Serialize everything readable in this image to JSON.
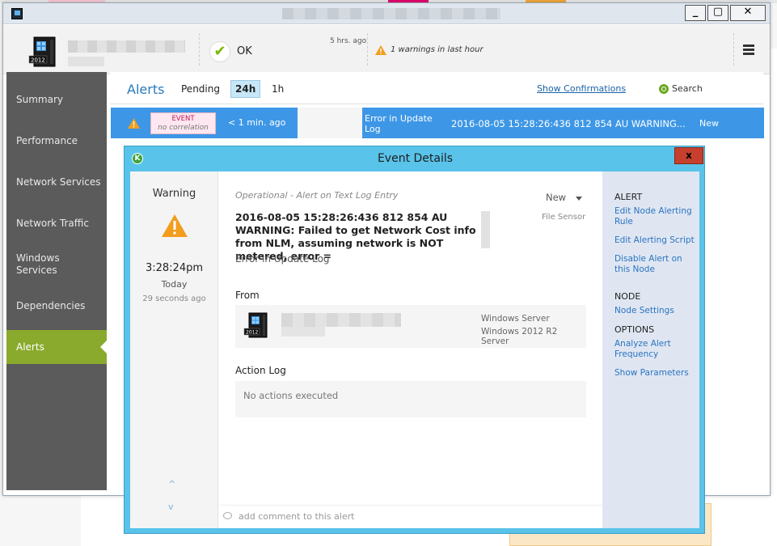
{
  "header": {
    "status_text": "OK",
    "status_time": "5 hrs. ago",
    "warnings_text": "1 warnings in last hour"
  },
  "sidebar": {
    "items": [
      {
        "label": "Summary"
      },
      {
        "label": "Performance"
      },
      {
        "label": "Network Services"
      },
      {
        "label": "Network Traffic"
      },
      {
        "label": "Windows Services"
      },
      {
        "label": "Dependencies"
      },
      {
        "label": "Alerts",
        "active": true
      }
    ]
  },
  "alerts": {
    "title": "Alerts",
    "tabs": [
      "Pending",
      "24h",
      "1h"
    ],
    "selected_tab": "24h",
    "show_confirmations": "Show Confirmations",
    "search_label": "Search",
    "row": {
      "type_label": "EVENT",
      "correlation": "no correlation",
      "time": "< 1 min. ago",
      "title": "Error in Update Log",
      "message": "2016-08-05 15:28:26:436 812 854 AU WARNING...",
      "status": "New"
    }
  },
  "dialog": {
    "title": "Event Details",
    "close_label": "x",
    "severity": "Warning",
    "time": "3:28:24pm",
    "day": "Today",
    "ago": "29 seconds ago",
    "event_type": "Operational - Alert on Text Log Entry",
    "status": "New",
    "sensor": "File Sensor",
    "message": "2016-08-05 15:28:26:436 812 854 AU WARNING: Failed to get Network Cost info from NLM, assuming network is NOT metered, error =",
    "subtitle": "Error in Update Log",
    "from_label": "From",
    "from_os1": "Windows Server",
    "from_os2": "Windows 2012 R2 Server",
    "from_icon_label": "2012",
    "action_log_label": "Action Log",
    "action_log_empty": "No actions executed",
    "comment_placeholder": "add comment to this alert",
    "nav_up": "^",
    "nav_down": "v",
    "sections": {
      "alert_heading": "ALERT",
      "edit_rule": "Edit Node Alerting Rule",
      "edit_script": "Edit Alerting Script",
      "disable_alert": "Disable Alert on this Node",
      "node_heading": "NODE",
      "node_settings": "Node Settings",
      "options_heading": "OPTIONS",
      "analyze_freq": "Analyze Alert Frequency",
      "show_params": "Show Parameters"
    }
  },
  "colors": {
    "accent_blue": "#3d97e6",
    "sidebar_active": "#8aaa2e",
    "dialog_frame": "#59c3ea",
    "warning": "#f29d1d"
  }
}
